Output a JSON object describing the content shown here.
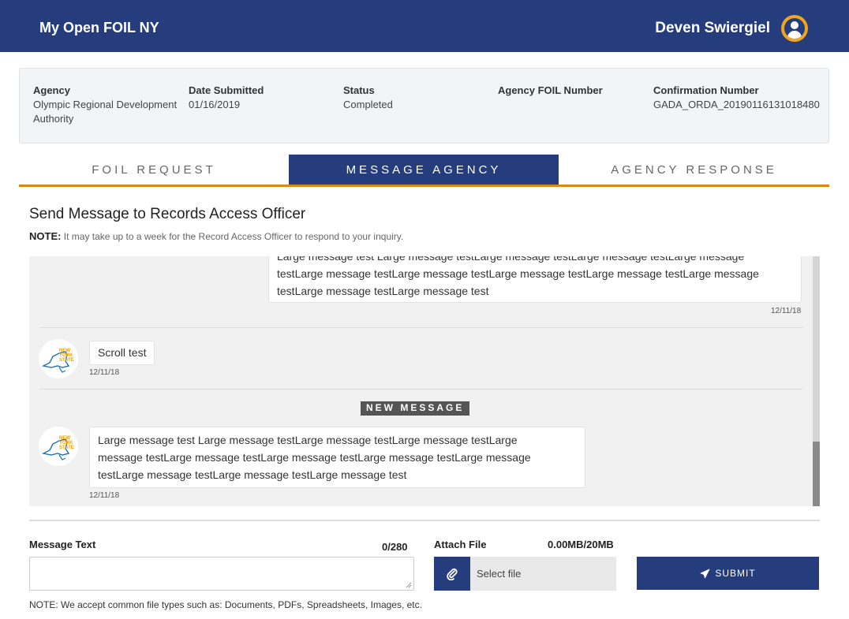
{
  "header": {
    "app_title": "My Open FOIL NY",
    "user_name": "Deven Swiergiel"
  },
  "request_info": {
    "agency_label": "Agency",
    "agency_value": "Olympic Regional Development Authority",
    "date_label": "Date Submitted",
    "date_value": "01/16/2019",
    "status_label": "Status",
    "status_value": "Completed",
    "foil_number_label": "Agency FOIL Number",
    "foil_number_value": "",
    "confirmation_label": "Confirmation Number",
    "confirmation_value": "GADA_ORDA_20190116131018480"
  },
  "tabs": [
    {
      "label": "FOIL REQUEST",
      "active": false
    },
    {
      "label": "MESSAGE AGENCY",
      "active": true
    },
    {
      "label": "AGENCY RESPONSE",
      "active": false
    }
  ],
  "section": {
    "title": "Send Message to Records Access Officer",
    "note_prefix": "NOTE:",
    "note_text": "It may take up to a week for the Record Access Officer to respond to your inquiry."
  },
  "messages": {
    "outgoing": {
      "line1": "Large message test Large message testLarge message testLarge message testLarge message",
      "line2": "testLarge message testLarge message testLarge message testLarge message testLarge message",
      "line3": "testLarge message testLarge message test",
      "time": "12/11/18"
    },
    "scroll": {
      "text": "Scroll test",
      "time": "12/11/18",
      "logo_text": "NEW YORK STATE"
    },
    "new_message_badge": "NEW MESSAGE",
    "large": {
      "line1": "Large message test Large message testLarge message testLarge message testLarge",
      "line2": "message testLarge message testLarge message testLarge message testLarge message",
      "line3": "testLarge message testLarge message testLarge message test",
      "time": "12/11/18",
      "logo_text": "NEW YORK STATE"
    }
  },
  "compose": {
    "message_label": "Message Text",
    "counter": "0/280",
    "attach_label": "Attach File",
    "size_label": "0.00MB/20MB",
    "select_file": "Select file",
    "submit": "SUBMIT",
    "file_note": "NOTE: We accept common file types such as: Documents, PDFs, Spreadsheets, Images, etc."
  },
  "colors": {
    "primary": "#253d7c",
    "accent": "#d98a13",
    "avatar": "#f1a51e"
  },
  "icons": {
    "avatar": "user-circle-icon",
    "attach": "paperclip-icon",
    "submit": "paper-plane-icon"
  }
}
